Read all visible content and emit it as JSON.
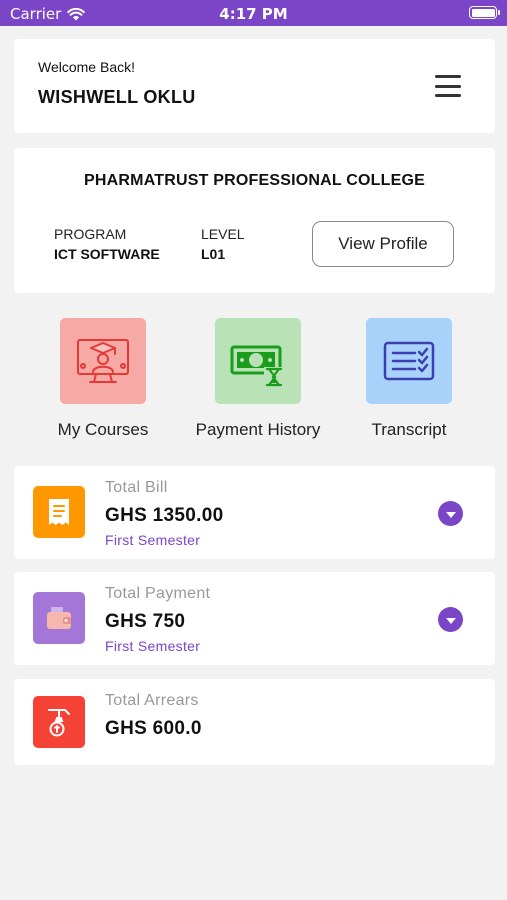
{
  "status_bar": {
    "carrier": "Carrier",
    "time": "4:17 PM"
  },
  "welcome": {
    "greeting": "Welcome Back!",
    "name": "WISHWELL OKLU"
  },
  "college": {
    "name": "PHARMATRUST PROFESSIONAL COLLEGE",
    "program_label": "PROGRAM",
    "program_value": "ICT SOFTWARE",
    "level_label": "LEVEL",
    "level_value": "L01",
    "view_profile_label": "View Profile"
  },
  "quick_actions": [
    {
      "label": "My Courses",
      "icon": "online-course-icon",
      "bg": "#f7a9a5"
    },
    {
      "label": "Payment History",
      "icon": "money-hourglass-icon",
      "bg": "#b9e2b7"
    },
    {
      "label": "Transcript",
      "icon": "checklist-icon",
      "bg": "#a9d2fb"
    }
  ],
  "summaries": [
    {
      "title": "Total Bill",
      "amount": "GHS 1350.00",
      "subtitle": "First Semester",
      "icon": "receipt-icon",
      "color": "#ff9800"
    },
    {
      "title": "Total Payment",
      "amount": "GHS 750",
      "subtitle": "First Semester",
      "icon": "wallet-icon",
      "color": "#a476d8"
    },
    {
      "title": "Total Arrears",
      "amount": "GHS 600.0",
      "icon": "coin-icon",
      "color": "#f44336"
    }
  ],
  "colors": {
    "accent": "#7b45c7"
  }
}
